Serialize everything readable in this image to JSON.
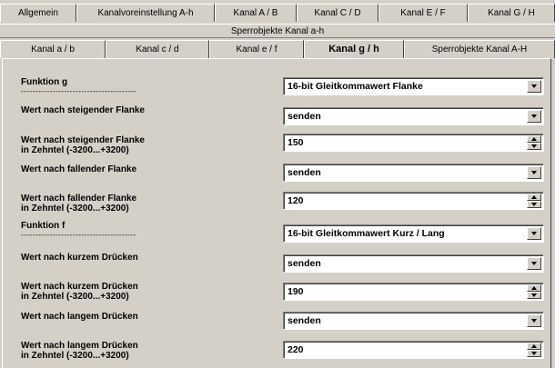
{
  "top_tabs": [
    "Allgemein",
    "Kanalvoreinstellung A-h",
    "Kanal A / B",
    "Kanal C / D",
    "Kanal E / F",
    "Kanal G / H"
  ],
  "group_label": "Sperrobjekte Kanal a-h",
  "sub_tabs": [
    "Kanal a / b",
    "Kanal c / d",
    "Kanal e / f",
    "Kanal g / h",
    "Sperrobjekte Kanal A-H"
  ],
  "active_sub_tab": "Kanal g / h",
  "separator": "----------------------------------------",
  "rows": {
    "funktion_g": {
      "label": "Funktion g",
      "value": "16-bit Gleitkommawert Flanke"
    },
    "wert_steigend": {
      "label": "Wert nach steigender Flanke",
      "value": "senden"
    },
    "wert_steigend_zehntel": {
      "label1": "Wert nach steigender Flanke",
      "label2": "in Zehntel (-3200...+3200)",
      "value": "150"
    },
    "wert_fallend": {
      "label": "Wert nach fallender Flanke",
      "value": "senden"
    },
    "wert_fallend_zehntel": {
      "label1": "Wert nach fallender Flanke",
      "label2": "in Zehntel (-3200...+3200)",
      "value": "120"
    },
    "funktion_f": {
      "label": "Funktion f",
      "value": "16-bit Gleitkommawert Kurz / Lang"
    },
    "wert_kurz": {
      "label": "Wert nach kurzem Drücken",
      "value": "senden"
    },
    "wert_kurz_zehntel": {
      "label1": "Wert nach kurzem Drücken",
      "label2": "in Zehntel (-3200...+3200)",
      "value": "190"
    },
    "wert_lang": {
      "label": "Wert nach langem Drücken",
      "value": "senden"
    },
    "wert_lang_zehntel": {
      "label1": "Wert nach langem Drücken",
      "label2": "in Zehntel (-3200...+3200)",
      "value": "220"
    }
  },
  "icons": {
    "dropdown": "chevron-down-icon",
    "spinner": "spin-arrows-icon"
  }
}
